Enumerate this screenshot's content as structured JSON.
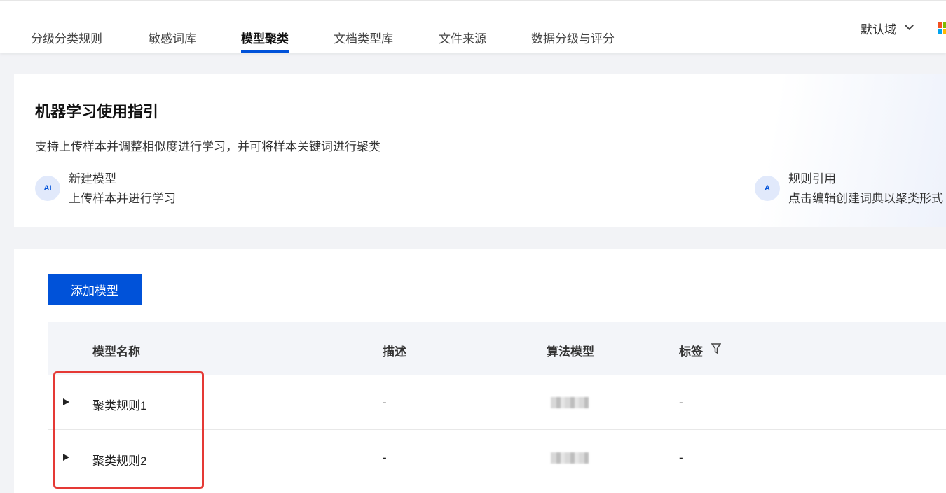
{
  "tabs": [
    {
      "label": "分级分类规则"
    },
    {
      "label": "敏感词库"
    },
    {
      "label": "模型聚类",
      "active": true
    },
    {
      "label": "文档类型库"
    },
    {
      "label": "文件来源"
    },
    {
      "label": "数据分级与评分"
    }
  ],
  "header": {
    "domain": "默认域",
    "accent": "#0052d9"
  },
  "guide": {
    "title": "机器学习使用指引",
    "desc": "支持上传样本并调整相似度进行学习，并可将样本关键词进行聚类",
    "features": [
      {
        "icon": "ai-icon",
        "icon_text": "AI",
        "title": "新建模型",
        "sub": "上传样本并进行学习"
      },
      {
        "icon": "text-recognition-icon",
        "icon_text": "A",
        "title": "规则引用",
        "sub": "点击编辑创建词典以聚类形式"
      }
    ]
  },
  "table": {
    "add_button": "添加模型",
    "columns": [
      "模型名称",
      "描述",
      "算法模型",
      "标签"
    ],
    "rows": [
      {
        "name": "聚类规则1",
        "desc": "-",
        "tag": "-"
      },
      {
        "name": "聚类规则2",
        "desc": "-",
        "tag": "-"
      }
    ]
  }
}
